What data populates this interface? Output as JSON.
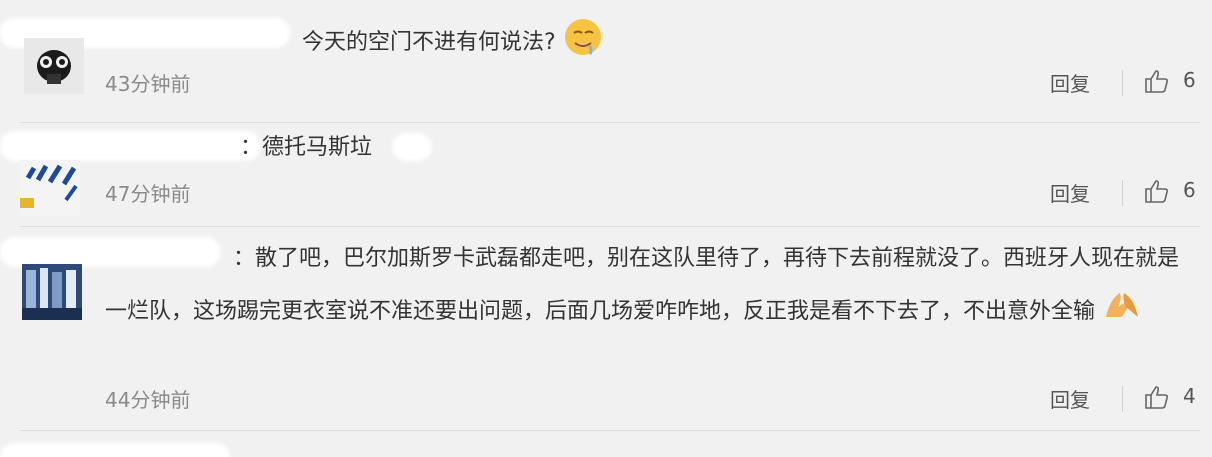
{
  "comments": [
    {
      "text": "今天的空门不进有何说法?",
      "time": "43分钟前",
      "reply": "回复",
      "likes": "6"
    },
    {
      "text": "：德托马斯垃",
      "time": "47分钟前",
      "reply": "回复",
      "likes": "6"
    },
    {
      "text": "：散了吧，巴尔加斯罗卡武磊都走吧，别在这队里待了，再待下去前程就没了。西班牙人现在就是一烂队，这场踢完更衣室说不准还要出问题，后面几场爱咋咋地，反正我是看不下去了，不出意外全输",
      "time": "44分钟前",
      "reply": "回复",
      "likes": "4"
    },
    {
      "text": "",
      "time": "",
      "reply": "",
      "likes": ""
    }
  ],
  "colors": {
    "background": "#f1f1f1",
    "text": "#333333",
    "meta": "#8a8a8a",
    "divider": "#dcdcdc"
  },
  "icons": {
    "like": "thumbs-up-icon",
    "emoji1": "drooling-face-emoji",
    "emoji2": "praying-hands-emoji"
  }
}
